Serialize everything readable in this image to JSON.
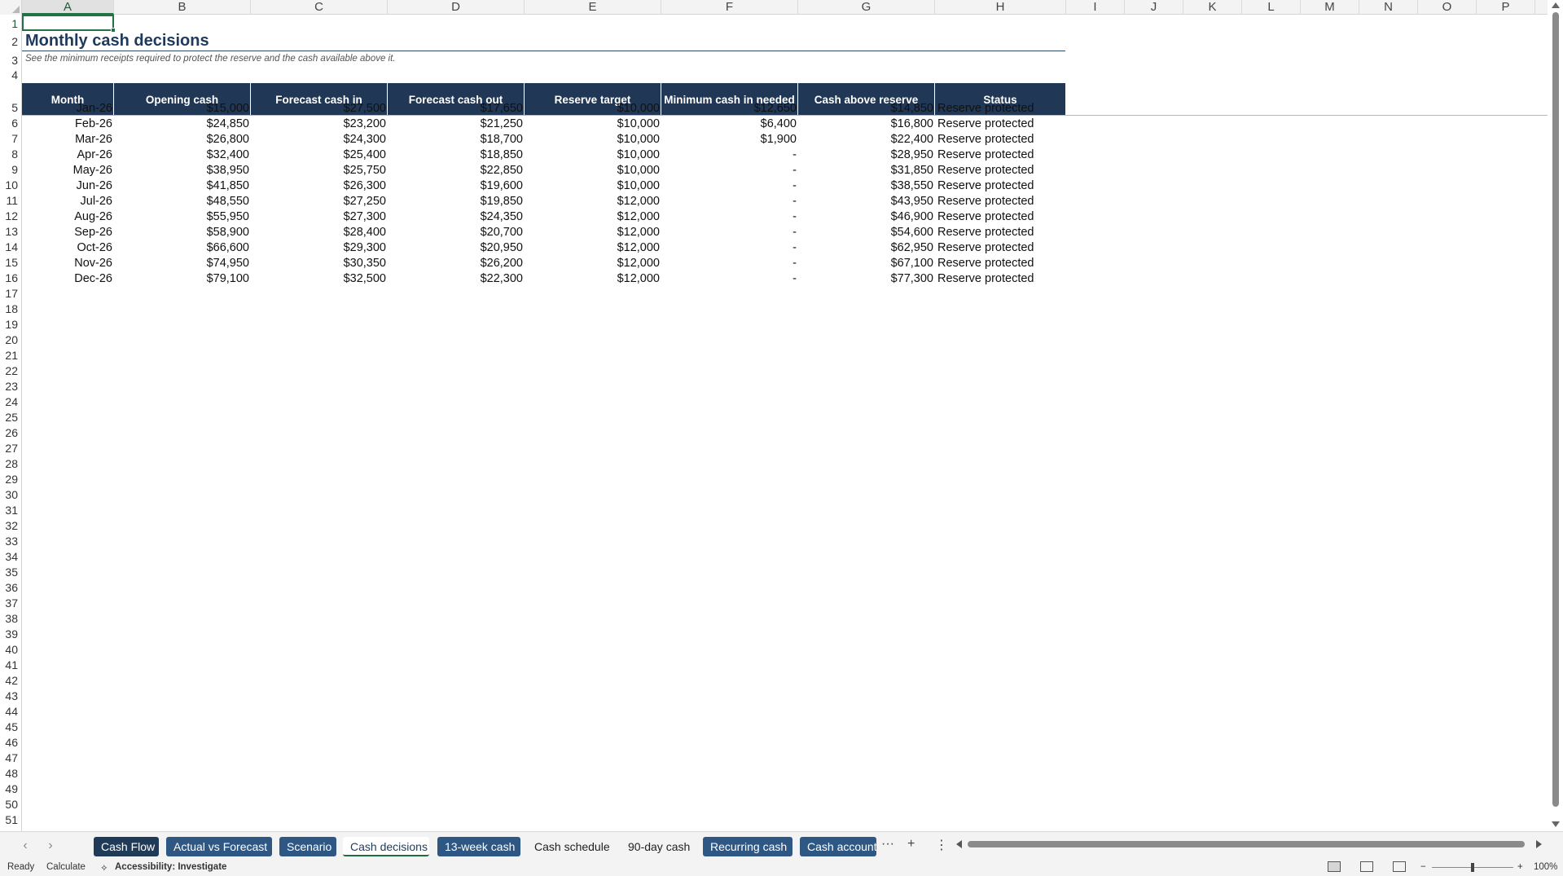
{
  "columns": [
    "A",
    "B",
    "C",
    "D",
    "E",
    "F",
    "G",
    "H",
    "I",
    "J",
    "K",
    "L",
    "M",
    "N",
    "O",
    "P"
  ],
  "rows_visible": [
    "1",
    "2",
    "3",
    "4",
    "5",
    "6",
    "7",
    "8",
    "9",
    "10",
    "11",
    "12",
    "13",
    "14",
    "15",
    "16",
    "17",
    "18",
    "19",
    "20",
    "21",
    "22",
    "23",
    "24",
    "25",
    "26",
    "27",
    "28",
    "29",
    "30",
    "31",
    "32",
    "33",
    "34",
    "35",
    "36",
    "37",
    "38",
    "39",
    "40",
    "41",
    "42",
    "43",
    "44",
    "45",
    "46",
    "47",
    "48",
    "49",
    "50",
    "51"
  ],
  "sheet": {
    "title": "Monthly cash decisions",
    "subtitle": "See the minimum receipts required to protect the reserve and the cash available above it.",
    "headers": [
      "Month",
      "Opening cash",
      "Forecast cash in",
      "Forecast cash out",
      "Reserve target",
      "Minimum cash in needed",
      "Cash above reserve",
      "Status"
    ],
    "rows": [
      [
        "Jan-26",
        "$15,000",
        "$27,500",
        "$17,650",
        "$10,000",
        "$12,650",
        "$14,850",
        "Reserve protected"
      ],
      [
        "Feb-26",
        "$24,850",
        "$23,200",
        "$21,250",
        "$10,000",
        "$6,400",
        "$16,800",
        "Reserve protected"
      ],
      [
        "Mar-26",
        "$26,800",
        "$24,300",
        "$18,700",
        "$10,000",
        "$1,900",
        "$22,400",
        "Reserve protected"
      ],
      [
        "Apr-26",
        "$32,400",
        "$25,400",
        "$18,850",
        "$10,000",
        "-",
        "$28,950",
        "Reserve protected"
      ],
      [
        "May-26",
        "$38,950",
        "$25,750",
        "$22,850",
        "$10,000",
        "-",
        "$31,850",
        "Reserve protected"
      ],
      [
        "Jun-26",
        "$41,850",
        "$26,300",
        "$19,600",
        "$10,000",
        "-",
        "$38,550",
        "Reserve protected"
      ],
      [
        "Jul-26",
        "$48,550",
        "$27,250",
        "$19,850",
        "$12,000",
        "-",
        "$43,950",
        "Reserve protected"
      ],
      [
        "Aug-26",
        "$55,950",
        "$27,300",
        "$24,350",
        "$12,000",
        "-",
        "$46,900",
        "Reserve protected"
      ],
      [
        "Sep-26",
        "$58,900",
        "$28,400",
        "$20,700",
        "$12,000",
        "-",
        "$54,600",
        "Reserve protected"
      ],
      [
        "Oct-26",
        "$66,600",
        "$29,300",
        "$20,950",
        "$12,000",
        "-",
        "$62,950",
        "Reserve protected"
      ],
      [
        "Nov-26",
        "$74,950",
        "$30,350",
        "$26,200",
        "$12,000",
        "-",
        "$67,100",
        "Reserve protected"
      ],
      [
        "Dec-26",
        "$79,100",
        "$32,500",
        "$22,300",
        "$12,000",
        "-",
        "$77,300",
        "Reserve protected"
      ]
    ]
  },
  "tabs": [
    {
      "label": "Cash Flow",
      "style": "dark"
    },
    {
      "label": "Actual vs Forecast",
      "style": "blue"
    },
    {
      "label": "Scenario",
      "style": "blue"
    },
    {
      "label": "Cash decisions",
      "style": "active"
    },
    {
      "label": "13-week cash",
      "style": "blue"
    },
    {
      "label": "Cash schedule",
      "style": "plain"
    },
    {
      "label": "90-day cash",
      "style": "plain"
    },
    {
      "label": "Recurring cash",
      "style": "blue"
    },
    {
      "label": "Cash account",
      "style": "blue"
    }
  ],
  "tab_more": "···",
  "tab_add": "+",
  "tab_options": "⋮",
  "status": {
    "ready": "Ready",
    "calculate": "Calculate",
    "accessibility": "Accessibility: Investigate",
    "zoom": "100%",
    "zoom_minus": "−",
    "zoom_plus": "+"
  },
  "colors": {
    "header_fill": "#203756",
    "accent_green": "#217346"
  }
}
